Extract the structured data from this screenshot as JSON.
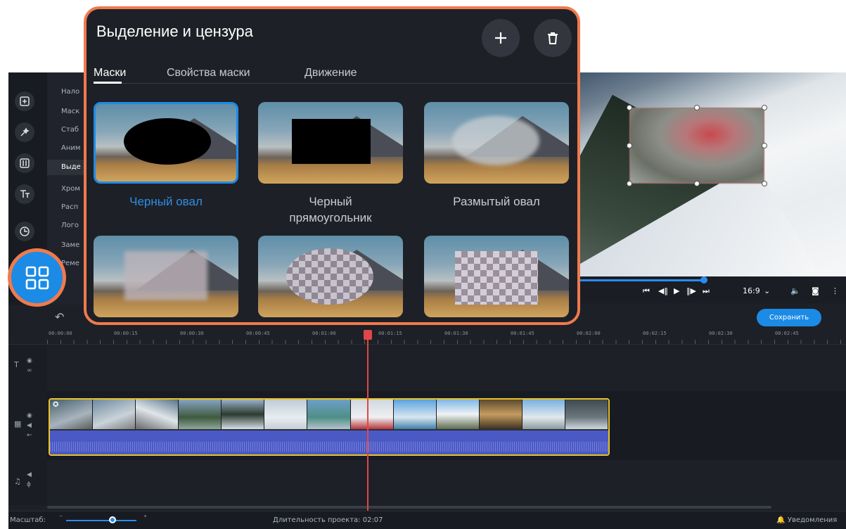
{
  "callout": {
    "title": "Выделение и цензура",
    "add_icon": "plus-icon",
    "delete_icon": "trash-icon",
    "tabs": [
      {
        "label": "Маски"
      },
      {
        "label": "Свойства маски"
      },
      {
        "label": "Движение"
      }
    ],
    "masks": [
      {
        "label": "Черный овал",
        "selected": true
      },
      {
        "label": "Черный прямоугольник",
        "selected": false
      },
      {
        "label": "Размытый овал",
        "selected": false
      },
      {
        "label": "",
        "selected": false
      },
      {
        "label": "",
        "selected": false
      },
      {
        "label": "",
        "selected": false
      }
    ],
    "accent_color": "#1e8be6",
    "highlight_color": "#f07a4c"
  },
  "tool_panel": {
    "items": [
      "Нало",
      "Маск",
      "Стаб",
      "Аним",
      "Выде",
      "Хром",
      "Расп",
      "Лого",
      "Заме",
      "Реме"
    ]
  },
  "player": {
    "aspect_ratio": "16:9",
    "icons": [
      "prev-icon",
      "step-back-icon",
      "play-icon",
      "step-forward-icon",
      "next-icon",
      "volume-icon",
      "snapshot-icon",
      "more-icon"
    ]
  },
  "timeline": {
    "save_label": "Сохранить",
    "ruler_labels": [
      "00:00:00",
      "00:00:15",
      "00:00:30",
      "00:00:45",
      "00:01:00",
      "00:01:15",
      "00:01:30",
      "00:01:45",
      "00:02:00",
      "00:02:15",
      "00:02:30",
      "00:02:45"
    ]
  },
  "status": {
    "zoom_label": "Масштаб:",
    "duration": "Длительность проекта: 02:07",
    "notifications": "Уведомления"
  }
}
